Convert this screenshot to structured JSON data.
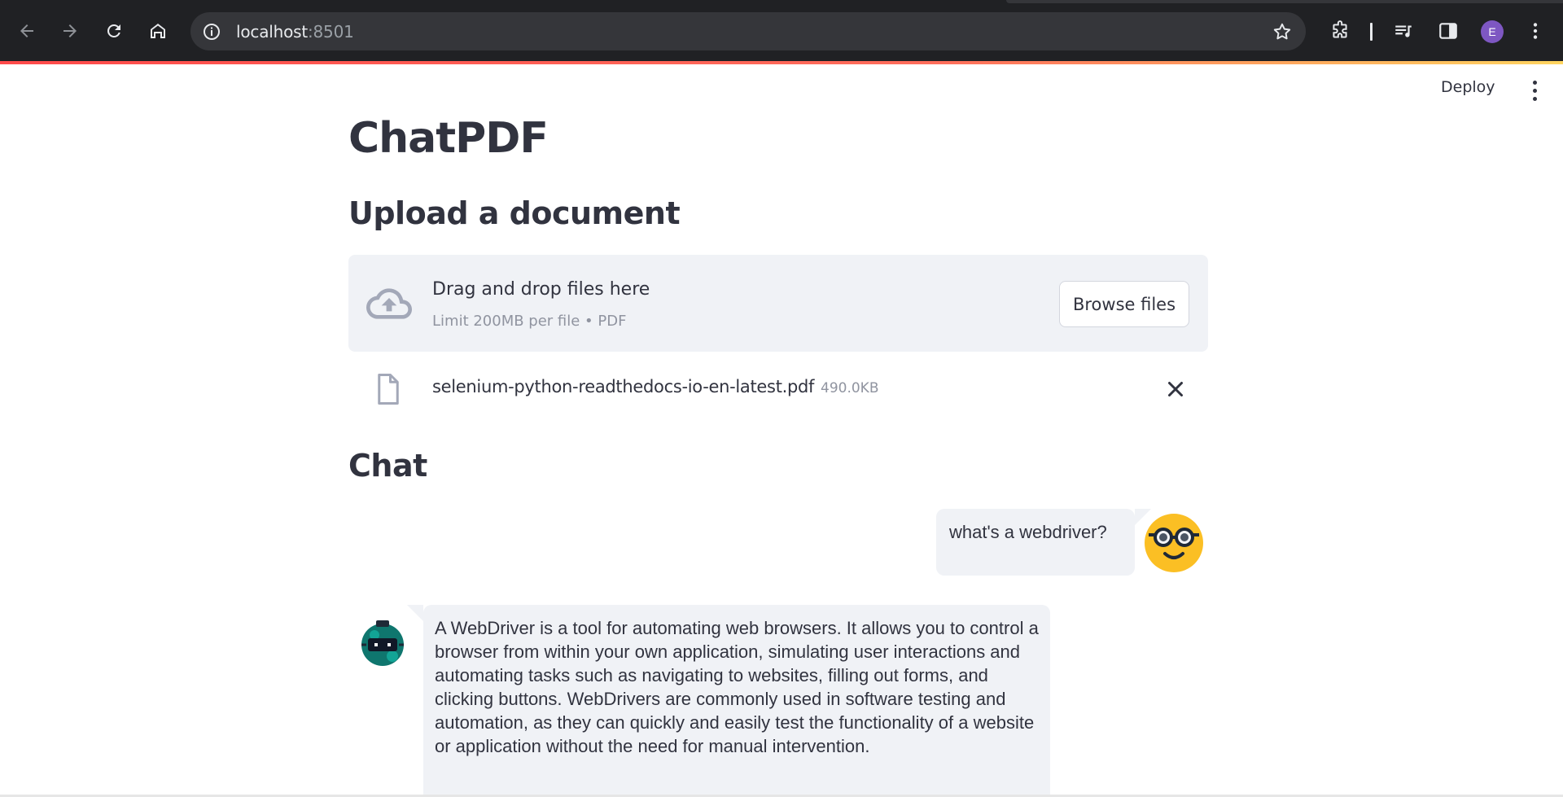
{
  "browser": {
    "url_host": "localhost",
    "url_port": ":8501",
    "profile_initial": "E"
  },
  "app_header": {
    "deploy_label": "Deploy"
  },
  "main": {
    "title": "ChatPDF",
    "upload_heading": "Upload a document",
    "dropzone": {
      "title": "Drag and drop files here",
      "subtitle": "Limit 200MB per file • PDF",
      "browse_label": "Browse files"
    },
    "uploaded_file": {
      "name": "selenium-python-readthedocs-io-en-latest.pdf",
      "size": "490.0KB"
    },
    "chat_heading": "Chat",
    "messages": [
      {
        "role": "user",
        "text": "what's a webdriver?"
      },
      {
        "role": "assistant",
        "text": "A WebDriver is a tool for automating web browsers. It allows you to control a browser from within your own application, simulating user interactions and automating tasks such as navigating to websites, filling out forms, and clicking buttons. WebDrivers are commonly used in software testing and automation, as they can quickly and easily test the functionality of a website or application without the need for manual intervention."
      }
    ]
  },
  "colors": {
    "browser_bg": "#202124",
    "omnibox_bg": "#35363a",
    "accent_red": "#ff4b4b",
    "panel_bg": "#f0f2f6",
    "text": "#31333f",
    "muted": "#9094a0"
  }
}
